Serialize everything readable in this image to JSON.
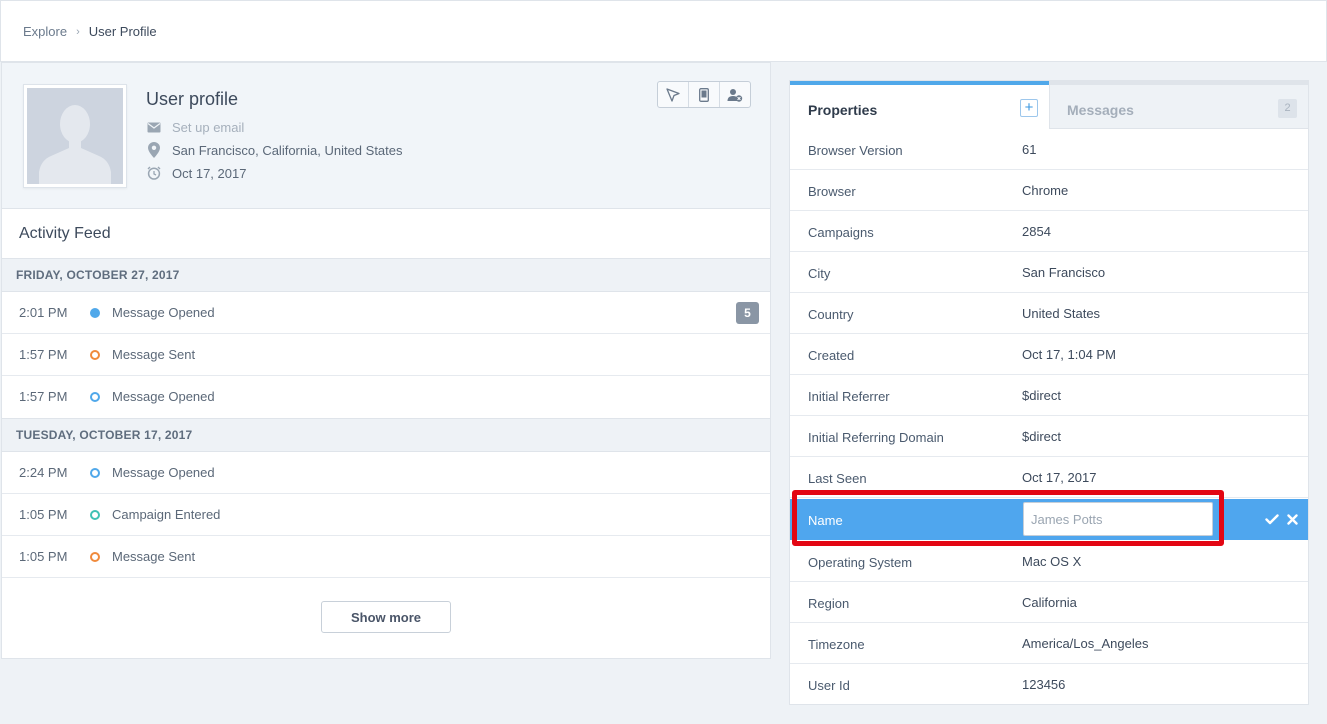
{
  "breadcrumb": {
    "explore": "Explore",
    "separator": "›",
    "current": "User Profile"
  },
  "profile": {
    "title": "User profile",
    "email": "Set up email",
    "location": "San Francisco, California, United States",
    "created": "Oct 17, 2017",
    "icons": {
      "email": "envelope-icon",
      "location": "map-pin-icon",
      "created": "alarm-clock-icon"
    },
    "tools": [
      "cursor-arrow-icon",
      "mobile-device-icon",
      "remove-user-icon"
    ]
  },
  "feed": {
    "title": "Activity Feed",
    "days": [
      {
        "label": "FRIDAY, OCTOBER 27, 2017",
        "events": [
          {
            "time": "2:01 PM",
            "label": "Message Opened",
            "dot": "filled",
            "color": "#50a8ea",
            "count": "5"
          },
          {
            "time": "1:57 PM",
            "label": "Message Sent",
            "dot": "ring",
            "color": "#f08a3c"
          },
          {
            "time": "1:57 PM",
            "label": "Message Opened",
            "dot": "ring",
            "color": "#50a8ea"
          }
        ]
      },
      {
        "label": "TUESDAY, OCTOBER 17, 2017",
        "events": [
          {
            "time": "2:24 PM",
            "label": "Message Opened",
            "dot": "ring",
            "color": "#50a8ea"
          },
          {
            "time": "1:05 PM",
            "label": "Campaign Entered",
            "dot": "ring",
            "color": "#3fc1b4"
          },
          {
            "time": "1:05 PM",
            "label": "Message Sent",
            "dot": "ring",
            "color": "#f08a3c"
          }
        ]
      }
    ],
    "show_more": "Show more"
  },
  "tabs": {
    "properties": "Properties",
    "add": "+",
    "messages": "Messages",
    "messages_count": "2"
  },
  "properties": [
    {
      "name": "Browser Version",
      "value": "61"
    },
    {
      "name": "Browser",
      "value": "Chrome"
    },
    {
      "name": "Campaigns",
      "value": "2854"
    },
    {
      "name": "City",
      "value": "San Francisco"
    },
    {
      "name": "Country",
      "value": "United States"
    },
    {
      "name": "Created",
      "value": "Oct 17, 1:04 PM"
    },
    {
      "name": "Initial Referrer",
      "value": "$direct"
    },
    {
      "name": "Initial Referring Domain",
      "value": "$direct"
    },
    {
      "name": "Last Seen",
      "value": "Oct 17, 2017"
    },
    {
      "name": "Name",
      "value": "",
      "placeholder": "James Potts",
      "editing": true
    },
    {
      "name": "Operating System",
      "value": "Mac OS X"
    },
    {
      "name": "Region",
      "value": "California"
    },
    {
      "name": "Timezone",
      "value": "America/Los_Angeles"
    },
    {
      "name": "User Id",
      "value": "123456"
    }
  ],
  "colors": {
    "accent": "#50a8ea",
    "edit_row": "#4fa6ee",
    "highlight": "#e30613"
  }
}
